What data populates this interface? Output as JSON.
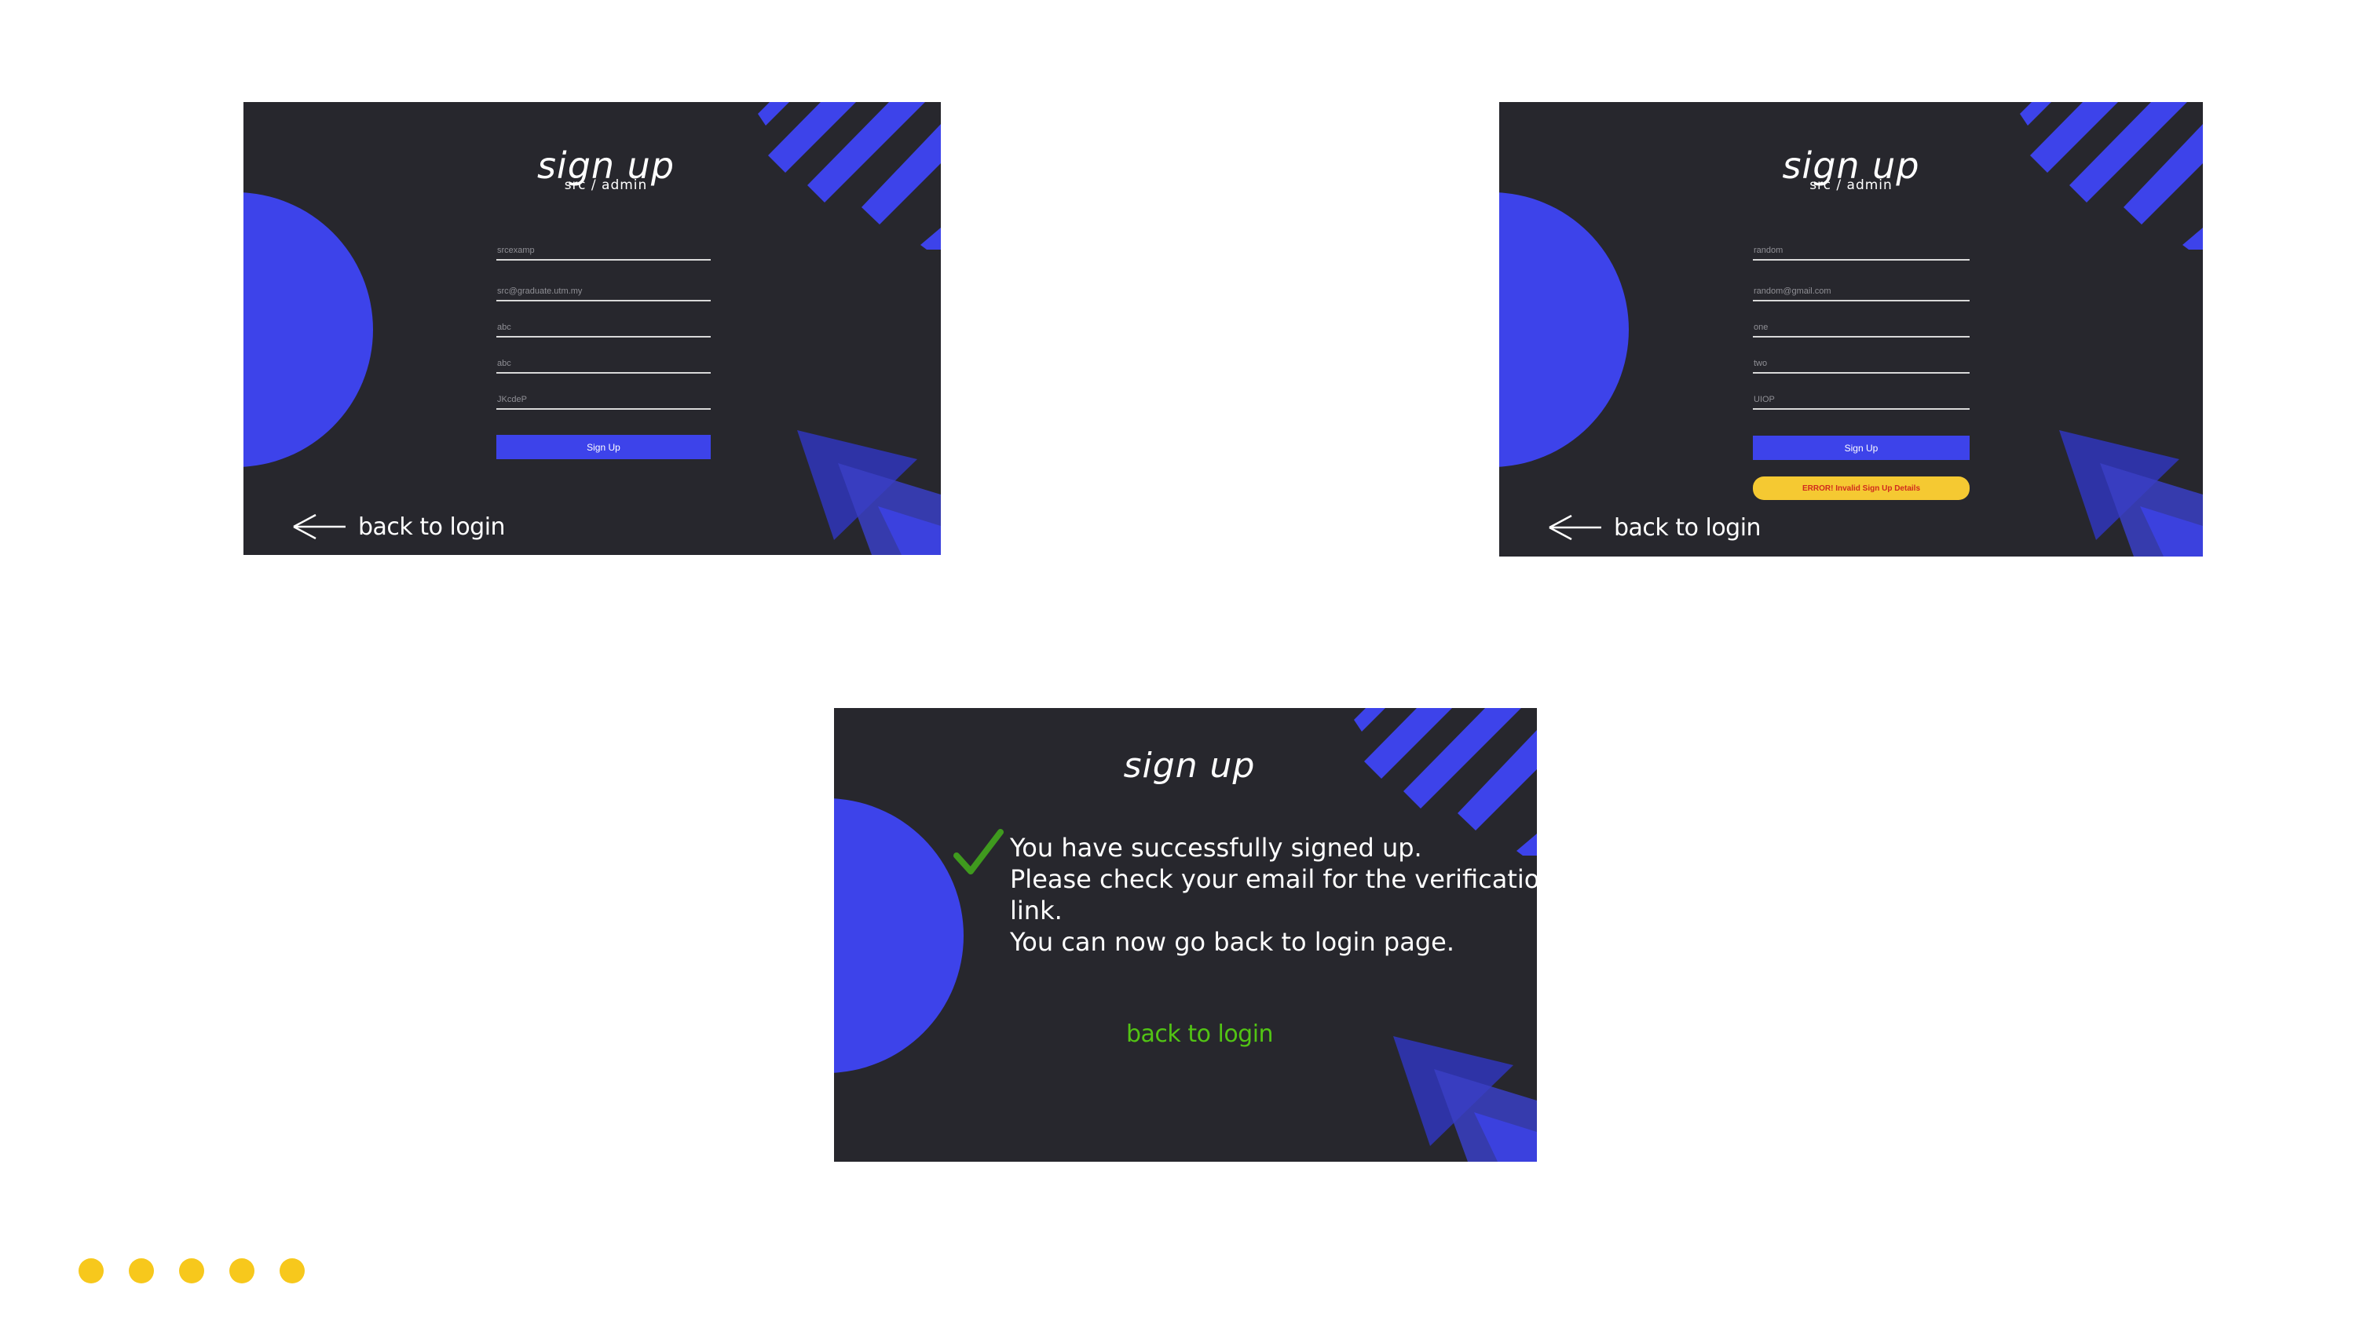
{
  "colors": {
    "card_bg": "#27272d",
    "accent_blue": "#3d43ea",
    "error_bg": "#f5c932",
    "error_text": "#d12a1e",
    "success_green": "#52c414",
    "dot_yellow": "#f7c81c"
  },
  "screen1": {
    "title": "sign up",
    "subtitle": "src / admin",
    "fields": [
      "srcexamp",
      "src@graduate.utm.my",
      "abc",
      "abc",
      "JKcdeP"
    ],
    "button": "Sign Up",
    "back_link": "back to login",
    "back_icon": "arrow-left-icon"
  },
  "screen2": {
    "title": "sign up",
    "subtitle": "src / admin",
    "fields": [
      "random",
      "random@gmail.com",
      "one",
      "two",
      "UIOP"
    ],
    "button": "Sign Up",
    "error": "ERROR! Invalid Sign Up Details",
    "back_link": "back to login",
    "back_icon": "arrow-left-icon"
  },
  "screen3": {
    "title": "sign up",
    "check_icon": "checkmark-icon",
    "message_lines": [
      "You have successfully signed up.",
      "Please check your email for the verification",
      "link.",
      "You can now go back to login page."
    ],
    "back_link": "back to login"
  },
  "pagination_dots": 5
}
